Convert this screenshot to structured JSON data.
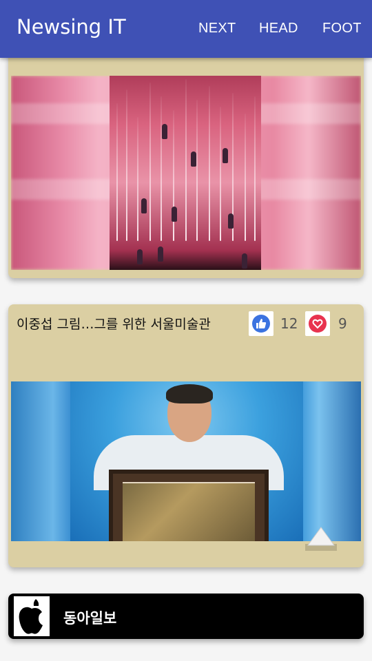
{
  "appbar": {
    "title": "Newsing IT",
    "actions": [
      "NEXT",
      "HEAD",
      "FOOT"
    ]
  },
  "article": {
    "title": "이중섭 그림…그를 위한 서울미술관",
    "likes": "12",
    "hearts": "9"
  },
  "source": {
    "name": "동아일보",
    "logo_icon": "apple-logo-icon"
  },
  "colors": {
    "appbar": "#3f51b5",
    "card": "#dbcfa3",
    "like": "#3b73e0",
    "heart": "#e8334f"
  }
}
